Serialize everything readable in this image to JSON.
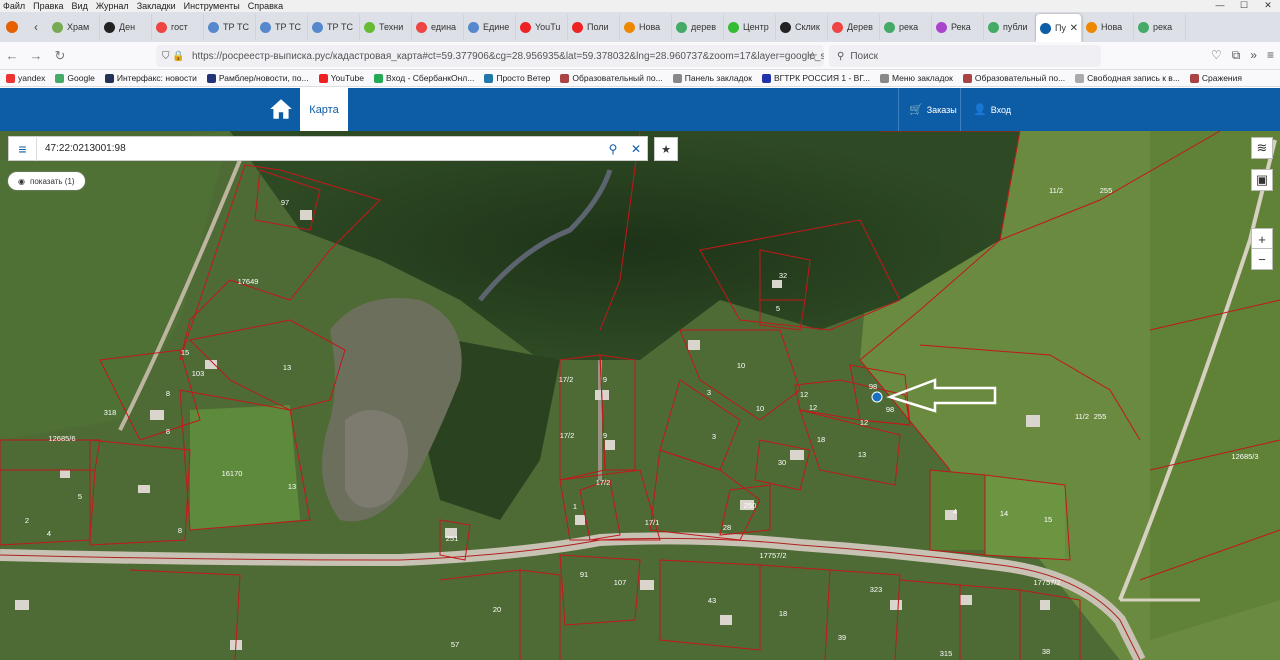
{
  "menubar": {
    "items": [
      "Файл",
      "Правка",
      "Вид",
      "Журнал",
      "Закладки",
      "Инструменты",
      "Справка"
    ]
  },
  "tabs": [
    {
      "label": "Храм",
      "color": "#7a5"
    },
    {
      "label": "Ден",
      "color": "#222"
    },
    {
      "label": "гост",
      "color": "#e44"
    },
    {
      "label": "ТР ТС",
      "color": "#58c"
    },
    {
      "label": "ТР ТС",
      "color": "#58c"
    },
    {
      "label": "ТР ТС",
      "color": "#58c"
    },
    {
      "label": "Техни",
      "color": "#6b3"
    },
    {
      "label": "едина",
      "color": "#e44"
    },
    {
      "label": "Едине",
      "color": "#58c"
    },
    {
      "label": "YouTu",
      "color": "#e22"
    },
    {
      "label": "Поли",
      "color": "#e22"
    },
    {
      "label": "Нова",
      "color": "#e80"
    },
    {
      "label": "дерев",
      "color": "#4a6"
    },
    {
      "label": "Центр",
      "color": "#3b3"
    },
    {
      "label": "Склик",
      "color": "#222"
    },
    {
      "label": "Дерев",
      "color": "#e44"
    },
    {
      "label": "река",
      "color": "#4a6"
    },
    {
      "label": "Река",
      "color": "#a4c"
    },
    {
      "label": "публи",
      "color": "#4a6"
    },
    {
      "label": "Пу",
      "color": "#0d5ca6",
      "active": true
    },
    {
      "label": "Нова",
      "color": "#e80"
    },
    {
      "label": "река",
      "color": "#4a6"
    }
  ],
  "nav": {
    "url": "https://росреестр-выписка.рус/кадастровая_карта#ct=59.377906&cg=28.956935&lat=59.378032&lng=28.960737&zoom=17&layer=google_sa",
    "search_placeholder": "Поиск"
  },
  "bookmarks": [
    {
      "label": "yandex",
      "color": "#e33"
    },
    {
      "label": "Google",
      "color": "#4a6"
    },
    {
      "label": "Интерфакс: новости",
      "color": "#235"
    },
    {
      "label": "Рамблер/новости, по...",
      "color": "#237"
    },
    {
      "label": "YouTube",
      "color": "#e22"
    },
    {
      "label": "Вход - СбербанкОнл...",
      "color": "#2a5"
    },
    {
      "label": "Просто Ветер",
      "color": "#27a"
    },
    {
      "label": "Образовательный по...",
      "color": "#a44"
    },
    {
      "label": "Панель закладок",
      "color": "#888"
    },
    {
      "label": "ВГТРК РОССИЯ 1 - ВГ...",
      "color": "#23a"
    },
    {
      "label": "Меню закладок",
      "color": "#888"
    },
    {
      "label": "Образовательный по...",
      "color": "#a44"
    },
    {
      "label": "Свободная запись к в...",
      "color": "#aaa"
    },
    {
      "label": "Сражения",
      "color": "#a44"
    }
  ],
  "app": {
    "tab_map": "Карта",
    "orders": "Заказы",
    "login": "Вход"
  },
  "cadastre": {
    "number": "47:22:0213001:98",
    "show_label": "показать (1)"
  },
  "map_controls": {
    "zoom_in": "+",
    "zoom_out": "−"
  },
  "parcels": [
    {
      "label": "97"
    },
    {
      "label": "17649"
    },
    {
      "label": "15"
    },
    {
      "label": "103"
    },
    {
      "label": "13"
    },
    {
      "label": "8"
    },
    {
      "label": "8"
    },
    {
      "label": "318"
    },
    {
      "label": "12685/6"
    },
    {
      "label": "16170"
    },
    {
      "label": "13"
    },
    {
      "label": "5"
    },
    {
      "label": "2"
    },
    {
      "label": "4"
    },
    {
      "label": "8"
    },
    {
      "label": "32"
    },
    {
      "label": "5"
    },
    {
      "label": "10"
    },
    {
      "label": "9"
    },
    {
      "label": "17/2"
    },
    {
      "label": "3"
    },
    {
      "label": "10"
    },
    {
      "label": "12"
    },
    {
      "label": "12"
    },
    {
      "label": "98"
    },
    {
      "label": "98"
    },
    {
      "label": "12"
    },
    {
      "label": "9"
    },
    {
      "label": "17/2"
    },
    {
      "label": "3"
    },
    {
      "label": "18"
    },
    {
      "label": "30"
    },
    {
      "label": "13"
    },
    {
      "label": "17/2"
    },
    {
      "label": "250"
    },
    {
      "label": "1"
    },
    {
      "label": "17/1"
    },
    {
      "label": "28"
    },
    {
      "label": "251"
    },
    {
      "label": "4"
    },
    {
      "label": "14"
    },
    {
      "label": "15"
    },
    {
      "label": "11/2"
    },
    {
      "label": "255"
    },
    {
      "label": "11/2"
    },
    {
      "label": "255"
    },
    {
      "label": "12685/3"
    },
    {
      "label": "17757/2"
    },
    {
      "label": "17757/2"
    },
    {
      "label": "91"
    },
    {
      "label": "107"
    },
    {
      "label": "43"
    },
    {
      "label": "18"
    },
    {
      "label": "39"
    },
    {
      "label": "323"
    },
    {
      "label": "20"
    },
    {
      "label": "57"
    },
    {
      "label": "315"
    },
    {
      "label": "38"
    }
  ]
}
